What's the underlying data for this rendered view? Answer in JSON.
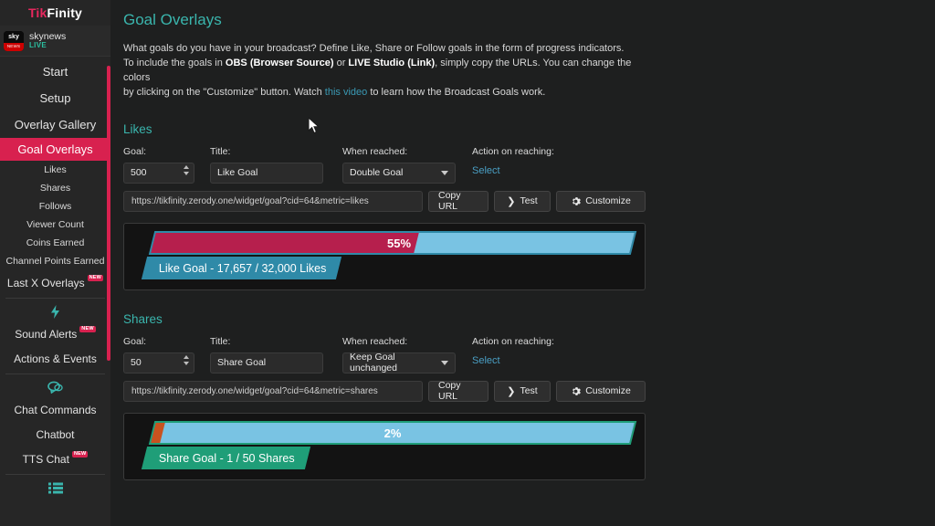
{
  "brand": {
    "part1": "Tik",
    "part2": "Finity"
  },
  "account": {
    "avatar_top": "sky",
    "avatar_bottom": "NEWS",
    "name": "skynews",
    "status": "LIVE"
  },
  "sidebar": {
    "main_items": [
      {
        "label": "Start"
      },
      {
        "label": "Setup"
      },
      {
        "label": "Overlay Gallery"
      }
    ],
    "active_item": {
      "label": "Goal Overlays"
    },
    "sub_items": [
      {
        "label": "Likes"
      },
      {
        "label": "Shares"
      },
      {
        "label": "Follows"
      },
      {
        "label": "Viewer Count"
      },
      {
        "label": "Coins Earned"
      },
      {
        "label": "Channel Points Earned"
      }
    ],
    "last_x": {
      "label": "Last X Overlays",
      "badge": "NEW"
    },
    "group_alerts": [
      {
        "label": "Sound Alerts",
        "badge": "NEW"
      },
      {
        "label": "Actions & Events",
        "badge": ""
      }
    ],
    "group_chat": [
      {
        "label": "Chat Commands",
        "badge": ""
      },
      {
        "label": "Chatbot",
        "badge": ""
      },
      {
        "label": "TTS Chat",
        "badge": "NEW"
      }
    ]
  },
  "header": {
    "title": "Goal Overlays",
    "desc_line1": "What goals do you have in your broadcast? Define Like, Share or Follow goals in the form of progress indicators.",
    "desc_l2_a": "To include the goals in ",
    "desc_l2_b": "OBS (Browser Source)",
    "desc_l2_c": " or ",
    "desc_l2_d": "LIVE Studio (Link)",
    "desc_l2_e": ", simply copy the URLs. You can change the colors",
    "desc_l3_a": "by clicking on the \"Customize\" button. Watch ",
    "desc_l3_link": "this video",
    "desc_l3_b": " to learn how the Broadcast Goals work."
  },
  "labels": {
    "goal": "Goal:",
    "title": "Title:",
    "when_reached": "When reached:",
    "action_on_reaching": "Action on reaching:",
    "select": "Select",
    "copy_url": "Copy URL",
    "test": "Test",
    "customize": "Customize"
  },
  "sections": [
    {
      "name": "Likes",
      "goal_value": "500",
      "title_value": "Like Goal",
      "title_placeholder": "Like Goal",
      "when_reached_value": "Double Goal",
      "when_reached_options": [
        "Double Goal",
        "Keep Goal unchanged"
      ],
      "url": "https://tikfinity.zerody.one/widget/goal?cid=64&metric=likes",
      "preview": {
        "percent_label": "55%",
        "percent_value": 55,
        "caption": "Like Goal - 17,657 / 32,000 Likes",
        "current": "17,657",
        "target": "32,000",
        "unit": "Likes",
        "fill_color": "#b61f4d",
        "track_color": "#79c3e3",
        "border_color": "#2f8aa8",
        "label_bg": "#2f8aa8"
      }
    },
    {
      "name": "Shares",
      "goal_value": "50",
      "title_value": "Share Goal",
      "title_placeholder": "Share Goal",
      "when_reached_value": "Keep Goal unchanged",
      "when_reached_options": [
        "Double Goal",
        "Keep Goal unchanged"
      ],
      "url": "https://tikfinity.zerody.one/widget/goal?cid=64&metric=shares",
      "preview": {
        "percent_label": "2%",
        "percent_value": 2,
        "caption": "Share Goal - 1 / 50 Shares",
        "current": "1",
        "target": "50",
        "unit": "Shares",
        "fill_color": "#c8521f",
        "track_color": "#79c3e3",
        "border_color": "#1f9e78",
        "label_bg": "#1f9e78"
      }
    }
  ],
  "colors": {
    "accent_pink": "#d8214f",
    "teal": "#3ab5ad",
    "link_blue": "#4a9fc4",
    "sidebar_bg": "#262626",
    "main_bg": "#1e1f1f"
  }
}
